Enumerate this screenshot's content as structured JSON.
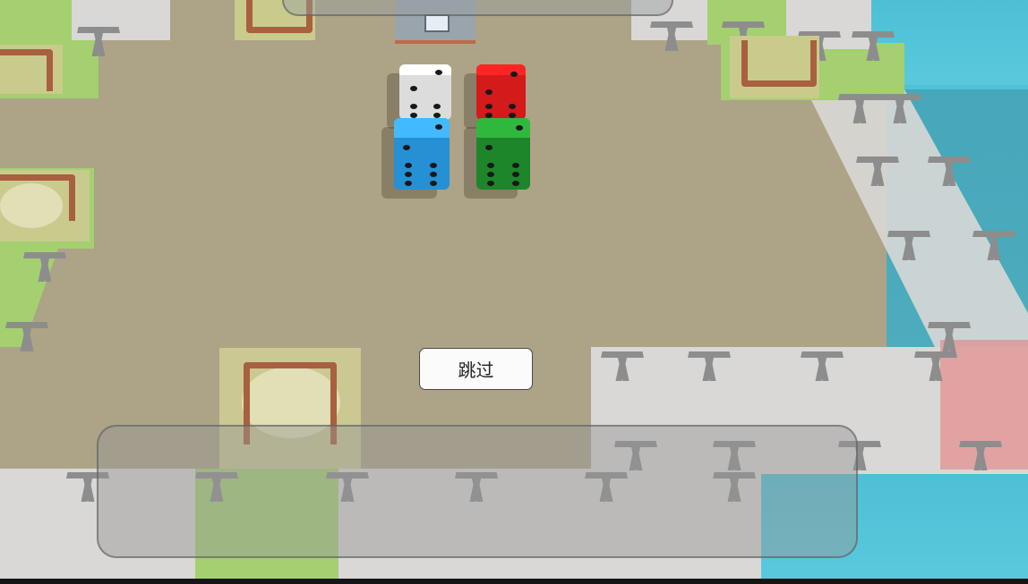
{
  "skip_button": {
    "label": "跳过"
  },
  "dice": [
    {
      "color": "white",
      "hex": "#e2e2e2"
    },
    {
      "color": "red",
      "hex": "#d81a1a"
    },
    {
      "color": "blue",
      "hex": "#2b93d8"
    },
    {
      "color": "green",
      "hex": "#1f8a28"
    }
  ]
}
